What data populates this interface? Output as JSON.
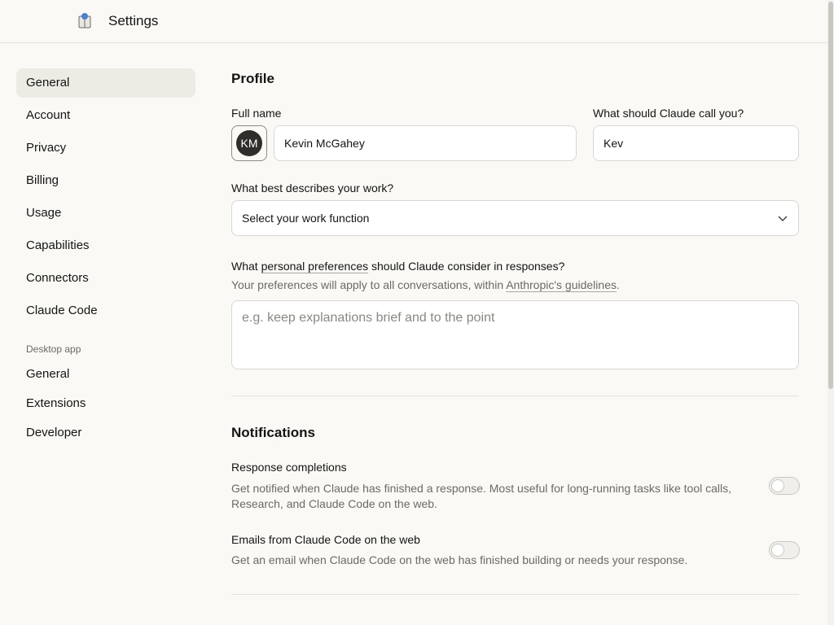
{
  "app": {
    "title": "Settings",
    "icon": "app-icon"
  },
  "sidebar": {
    "items": [
      {
        "label": "General",
        "active": true
      },
      {
        "label": "Account"
      },
      {
        "label": "Privacy"
      },
      {
        "label": "Billing"
      },
      {
        "label": "Usage"
      },
      {
        "label": "Capabilities"
      },
      {
        "label": "Connectors"
      },
      {
        "label": "Claude Code"
      }
    ],
    "section_label": "Desktop app",
    "desktop_items": [
      {
        "label": "General"
      },
      {
        "label": "Extensions"
      },
      {
        "label": "Developer"
      }
    ]
  },
  "profile": {
    "heading": "Profile",
    "full_name_label": "Full name",
    "avatar_initials": "KM",
    "full_name_value": "Kevin McGahey",
    "call_you_label": "What should Claude call you?",
    "call_you_value": "Kev",
    "work_label": "What best describes your work?",
    "work_select_value": "Select your work function",
    "prefs_label_pre": "What ",
    "prefs_label_link": "personal preferences",
    "prefs_label_post": " should Claude consider in responses?",
    "prefs_sub_pre": "Your preferences will apply to all conversations, within ",
    "prefs_sub_link": "Anthropic's guidelines",
    "prefs_sub_post": ".",
    "prefs_placeholder": "e.g. keep explanations brief and to the point"
  },
  "notifications": {
    "heading": "Notifications",
    "items": [
      {
        "title": "Response completions",
        "description": "Get notified when Claude has finished a response. Most useful for long-running tasks like tool calls, Research, and Claude Code on the web.",
        "enabled": false
      },
      {
        "title": "Emails from Claude Code on the web",
        "description": "Get an email when Claude Code on the web has finished building or needs your response.",
        "enabled": false
      }
    ]
  },
  "colors": {
    "background": "#faf9f5",
    "active_nav": "#ecebe4",
    "avatar": "#2f2e2b",
    "muted_text": "#6b6a65"
  }
}
